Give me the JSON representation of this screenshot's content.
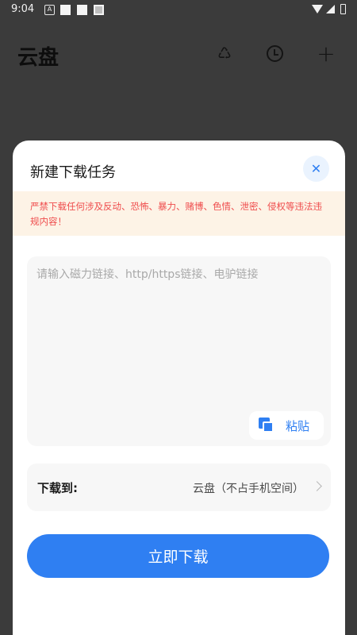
{
  "status_bar": {
    "time": "9:04",
    "notification_icon_a": "A"
  },
  "header": {
    "title": "云盘",
    "icons": [
      "recycle-icon",
      "history-icon",
      "add-icon"
    ]
  },
  "dialog": {
    "title": "新建下载任务",
    "close_symbol": "✕",
    "warning": "严禁下载任何涉及反动、恐怖、暴力、赌博、色情、泄密、侵权等违法违规内容！",
    "link_input": {
      "value": "",
      "placeholder": "请输入磁力链接、http/https链接、电驴链接"
    },
    "paste_label": "粘贴",
    "destination": {
      "label": "下载到:",
      "value": "云盘（不占手机空间）"
    },
    "download_button": "立即下载"
  },
  "colors": {
    "accent": "#2f7ff2",
    "warning_text": "#ef4d4d",
    "warning_bg": "#fdf3e6",
    "overlay": "#3b3b3b"
  }
}
